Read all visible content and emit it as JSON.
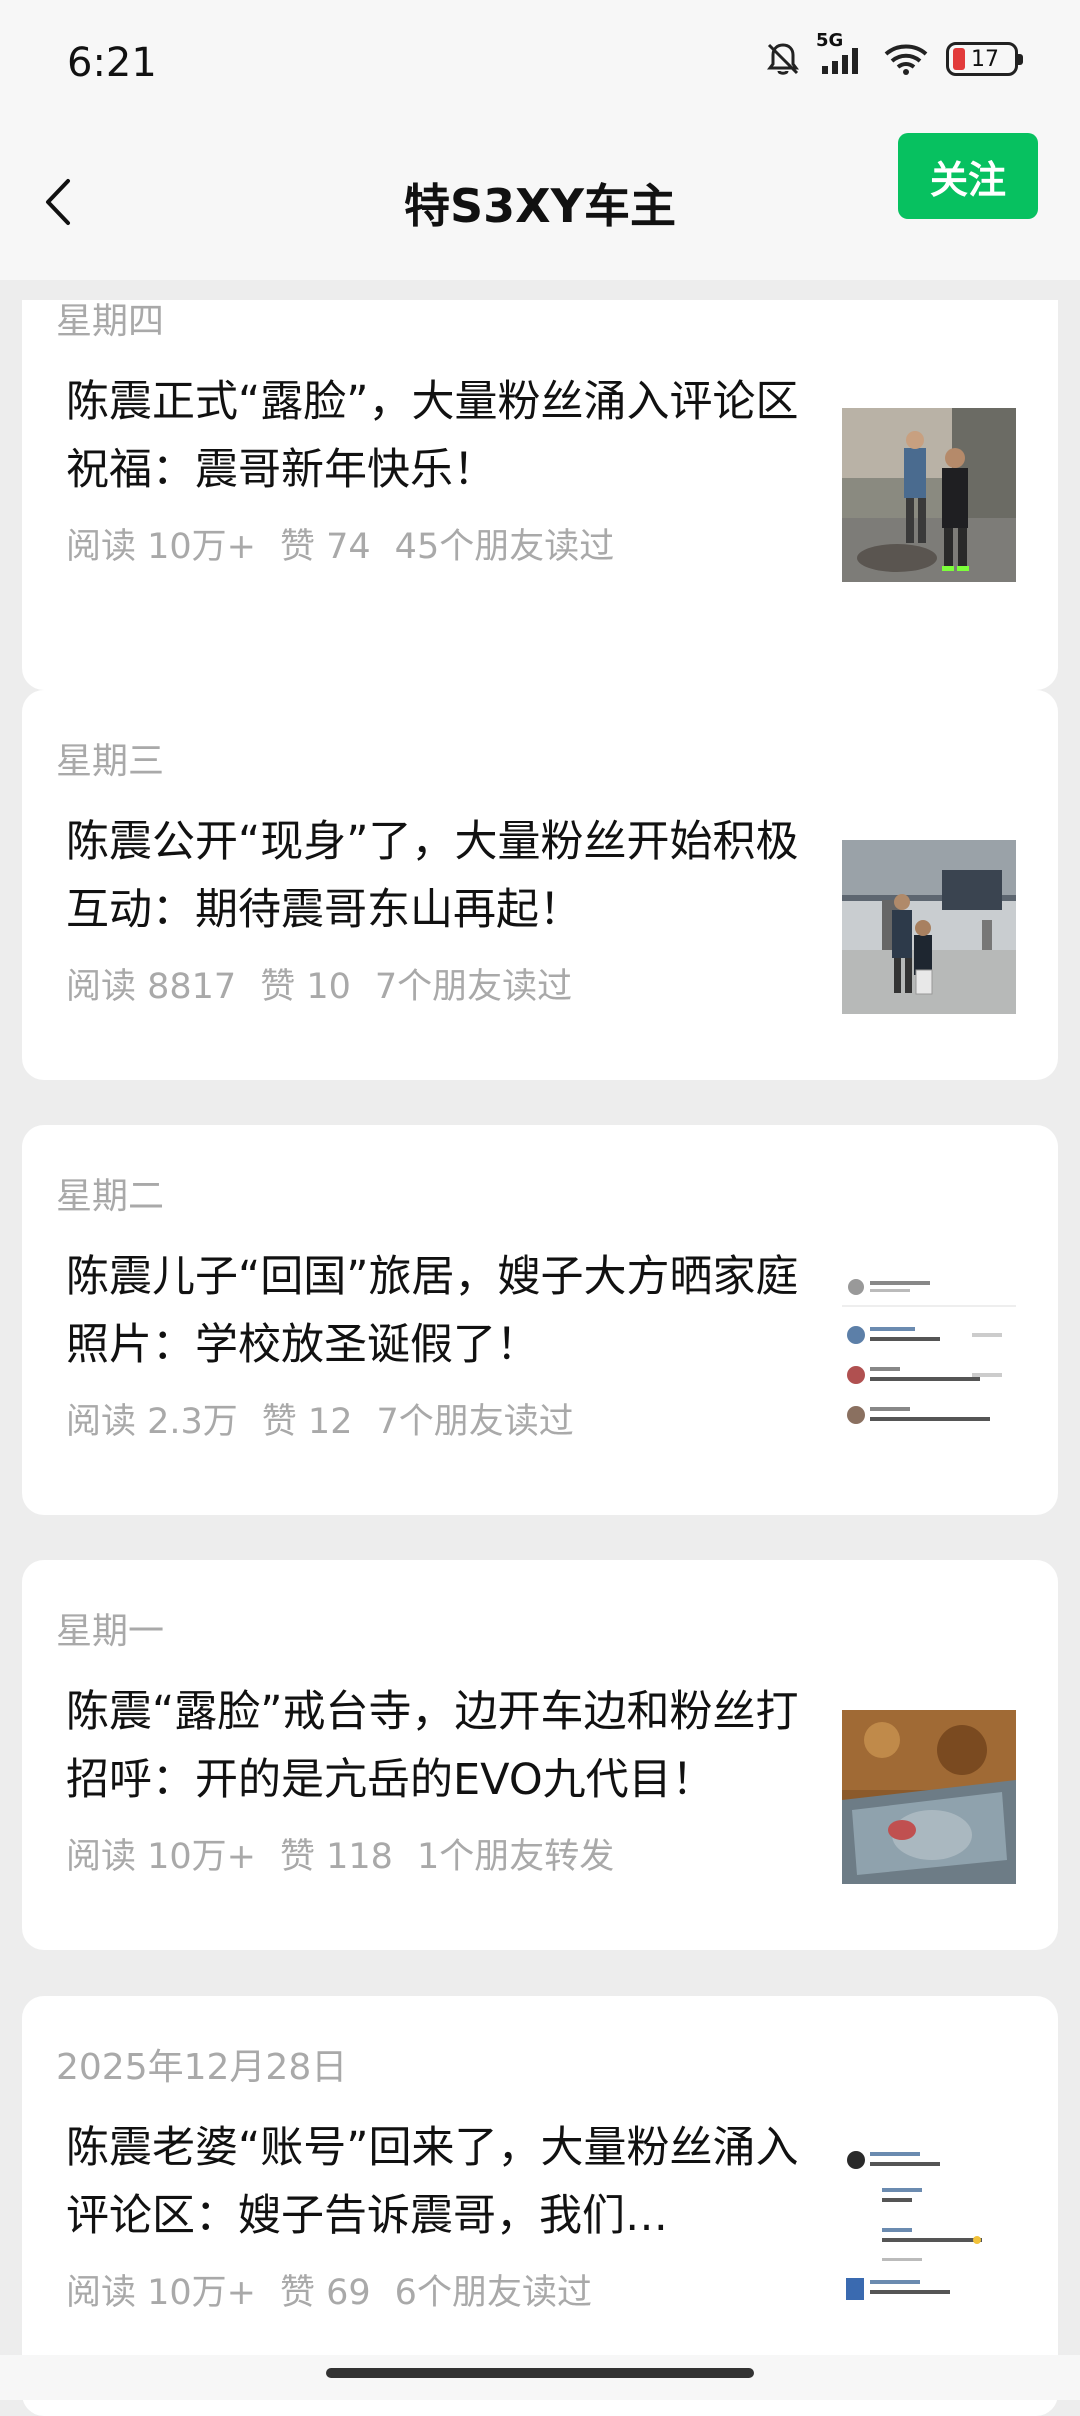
{
  "status_bar": {
    "time": "6:21",
    "network": "5G",
    "battery": "17"
  },
  "nav": {
    "title": "特S3XY车主",
    "follow_label": "关注"
  },
  "articles": [
    {
      "date": "星期四",
      "title": "陈震正式“露脸”，大量粉丝涌入评论区祝福：震哥新年快乐！",
      "reads": "阅读 10万+",
      "likes": "赞 74",
      "friends": "45个朋友读过"
    },
    {
      "date": "星期三",
      "title": "陈震公开“现身”了，大量粉丝开始积极互动：期待震哥东山再起！",
      "reads": "阅读 8817",
      "likes": "赞 10",
      "friends": "7个朋友读过"
    },
    {
      "date": "星期二",
      "title": "陈震儿子“回国”旅居，嫂子大方晒家庭照片：学校放圣诞假了！",
      "reads": "阅读 2.3万",
      "likes": "赞 12",
      "friends": "7个朋友读过"
    },
    {
      "date": "星期一",
      "title": "陈震“露脸”戒台寺，边开车边和粉丝打招呼：开的是亢岳的EVO九代目！",
      "reads": "阅读 10万+",
      "likes": "赞 118",
      "friends": "1个朋友转发"
    },
    {
      "date": "2025年12月28日",
      "title": "陈震老婆“账号”回来了，大量粉丝涌入评论区：嫂子告诉震哥，我们…",
      "reads": "阅读 10万+",
      "likes": "赞 69",
      "friends": "6个朋友读过"
    }
  ],
  "thumbnails": [
    "street-photo-thumbnail",
    "airport-photo-thumbnail",
    "comments-screenshot-thumbnail",
    "car-window-photo-thumbnail",
    "comments-screenshot-thumbnail"
  ],
  "icons": {
    "back": "chevron-left-icon",
    "mute": "bell-off-icon",
    "signal": "signal-icon",
    "wifi": "wifi-icon",
    "battery": "battery-icon"
  },
  "colors": {
    "accent": "#07c160",
    "background": "#ededed",
    "secondary_text": "#a9a9a9"
  }
}
